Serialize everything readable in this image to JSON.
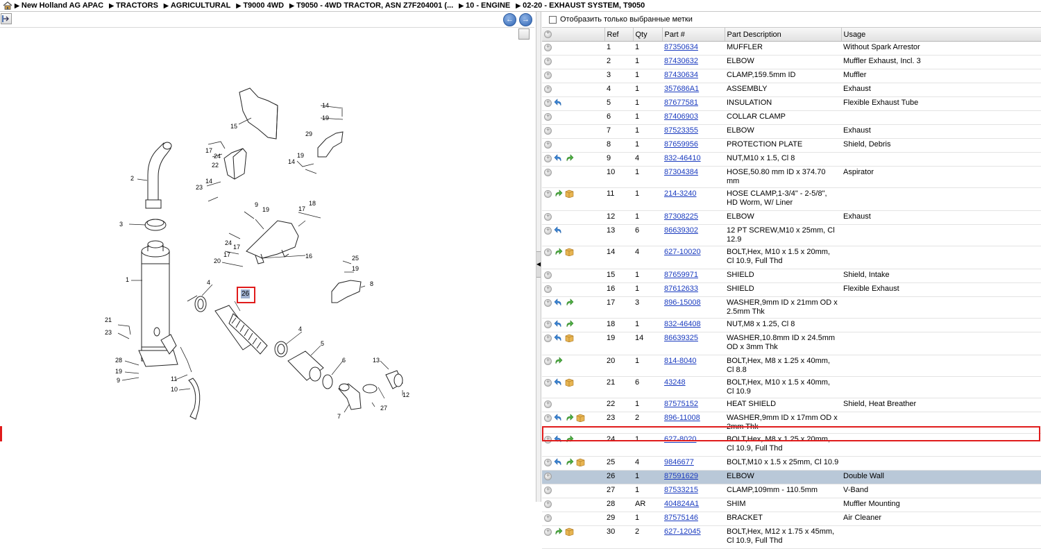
{
  "breadcrumb": [
    "New Holland AG APAC",
    "TRACTORS",
    "AGRICULTURAL",
    "T9000 4WD",
    "T9050 - 4WD TRACTOR, ASN Z7F204001 (...",
    "10 - ENGINE",
    "02-20 - EXHAUST SYSTEM, T9050"
  ],
  "filter_label": "Отобразить только выбранные метки",
  "columns": {
    "ref": "Ref",
    "qty": "Qty",
    "part": "Part #",
    "desc": "Part Description",
    "usage": "Usage"
  },
  "highlight_callout": "26",
  "rows": [
    {
      "ref": "1",
      "qty": "1",
      "part": "87350634",
      "desc": "MUFFLER",
      "usage": "Without Spark Arrestor",
      "icons": []
    },
    {
      "ref": "2",
      "qty": "1",
      "part": "87430632",
      "desc": "ELBOW",
      "usage": "Muffler Exhaust, Incl. 3",
      "icons": []
    },
    {
      "ref": "3",
      "qty": "1",
      "part": "87430634",
      "desc": "CLAMP,159.5mm ID",
      "usage": "Muffler",
      "icons": []
    },
    {
      "ref": "4",
      "qty": "1",
      "part": "357686A1",
      "desc": "ASSEMBLY",
      "usage": "Exhaust",
      "icons": []
    },
    {
      "ref": "5",
      "qty": "1",
      "part": "87677581",
      "desc": "INSULATION",
      "usage": "Flexible Exhaust Tube",
      "icons": [
        "back"
      ]
    },
    {
      "ref": "6",
      "qty": "1",
      "part": "87406903",
      "desc": "COLLAR CLAMP",
      "usage": "",
      "icons": []
    },
    {
      "ref": "7",
      "qty": "1",
      "part": "87523355",
      "desc": "ELBOW",
      "usage": "Exhaust",
      "icons": []
    },
    {
      "ref": "8",
      "qty": "1",
      "part": "87659956",
      "desc": "PROTECTION PLATE",
      "usage": "Shield, Debris",
      "icons": []
    },
    {
      "ref": "9",
      "qty": "4",
      "part": "832-46410",
      "desc": "NUT,M10 x 1.5, Cl 8",
      "usage": "",
      "icons": [
        "back",
        "fwd"
      ]
    },
    {
      "ref": "10",
      "qty": "1",
      "part": "87304384",
      "desc": "HOSE,50.80 mm ID x 374.70 mm",
      "usage": "Aspirator",
      "icons": []
    },
    {
      "ref": "11",
      "qty": "1",
      "part": "214-3240",
      "desc": "HOSE CLAMP,1-3/4\" - 2-5/8\", HD Worm, W/ Liner",
      "usage": "",
      "icons": [
        "fwd",
        "box"
      ]
    },
    {
      "ref": "12",
      "qty": "1",
      "part": "87308225",
      "desc": "ELBOW",
      "usage": "Exhaust",
      "icons": []
    },
    {
      "ref": "13",
      "qty": "6",
      "part": "86639302",
      "desc": "12 PT SCREW,M10 x 25mm, Cl 12.9",
      "usage": "",
      "icons": [
        "back"
      ]
    },
    {
      "ref": "14",
      "qty": "4",
      "part": "627-10020",
      "desc": "BOLT,Hex, M10 x 1.5 x 20mm, Cl 10.9, Full Thd",
      "usage": "",
      "icons": [
        "fwd",
        "box"
      ]
    },
    {
      "ref": "15",
      "qty": "1",
      "part": "87659971",
      "desc": "SHIELD",
      "usage": "Shield, Intake",
      "icons": []
    },
    {
      "ref": "16",
      "qty": "1",
      "part": "87612633",
      "desc": "SHIELD",
      "usage": "Flexible Exhaust",
      "icons": []
    },
    {
      "ref": "17",
      "qty": "3",
      "part": "896-15008",
      "desc": "WASHER,9mm ID x 21mm OD x 2.5mm Thk",
      "usage": "",
      "icons": [
        "back",
        "fwd"
      ]
    },
    {
      "ref": "18",
      "qty": "1",
      "part": "832-46408",
      "desc": "NUT,M8 x 1.25, Cl 8",
      "usage": "",
      "icons": [
        "back",
        "fwd"
      ]
    },
    {
      "ref": "19",
      "qty": "14",
      "part": "86639325",
      "desc": "WASHER,10.8mm ID x 24.5mm OD x 3mm Thk",
      "usage": "",
      "icons": [
        "back",
        "box"
      ]
    },
    {
      "ref": "20",
      "qty": "1",
      "part": "814-8040",
      "desc": "BOLT,Hex, M8 x 1.25 x 40mm, Cl 8.8",
      "usage": "",
      "icons": [
        "fwd"
      ]
    },
    {
      "ref": "21",
      "qty": "6",
      "part": "43248",
      "desc": "BOLT,Hex, M10 x 1.5 x 40mm, Cl 10.9",
      "usage": "",
      "icons": [
        "back",
        "box"
      ]
    },
    {
      "ref": "22",
      "qty": "1",
      "part": "87575152",
      "desc": "HEAT SHIELD",
      "usage": "Shield, Heat Breather",
      "icons": []
    },
    {
      "ref": "23",
      "qty": "2",
      "part": "896-11008",
      "desc": "WASHER,9mm ID x 17mm OD x 2mm Thk",
      "usage": "",
      "icons": [
        "back",
        "fwd",
        "box"
      ]
    },
    {
      "ref": "24",
      "qty": "1",
      "part": "627-8020",
      "desc": "BOLT,Hex, M8 x 1.25 x 20mm, Cl 10.9, Full Thd",
      "usage": "",
      "icons": [
        "back",
        "fwd"
      ]
    },
    {
      "ref": "25",
      "qty": "4",
      "part": "9846677",
      "desc": "BOLT,M10 x 1.5 x 25mm, Cl 10.9",
      "usage": "",
      "icons": [
        "back",
        "fwd",
        "box"
      ]
    },
    {
      "ref": "26",
      "qty": "1",
      "part": "87591629",
      "desc": "ELBOW",
      "usage": "Double Wall",
      "icons": [],
      "selected": true
    },
    {
      "ref": "27",
      "qty": "1",
      "part": "87533215",
      "desc": "CLAMP,109mm - 110.5mm",
      "usage": "V-Band",
      "icons": []
    },
    {
      "ref": "28",
      "qty": "AR",
      "part": "404824A1",
      "desc": "SHIM",
      "usage": "Muffler Mounting",
      "icons": []
    },
    {
      "ref": "29",
      "qty": "1",
      "part": "87575146",
      "desc": "BRACKET",
      "usage": "Air Cleaner",
      "icons": []
    },
    {
      "ref": "30",
      "qty": "2",
      "part": "627-12045",
      "desc": "BOLT,Hex, M12 x 1.75 x 45mm, Cl 10.9, Full Thd",
      "usage": "",
      "icons": [
        "fwd",
        "box"
      ]
    }
  ],
  "callouts": [
    "1",
    "2",
    "3",
    "4",
    "4",
    "5",
    "6",
    "7",
    "8",
    "9",
    "9",
    "10",
    "11",
    "12",
    "13",
    "14",
    "14",
    "14",
    "15",
    "16",
    "17",
    "17",
    "17",
    "18",
    "19",
    "19",
    "19",
    "19",
    "20",
    "21",
    "22",
    "23",
    "23",
    "24",
    "24",
    "25",
    "27",
    "28",
    "29",
    "26"
  ]
}
